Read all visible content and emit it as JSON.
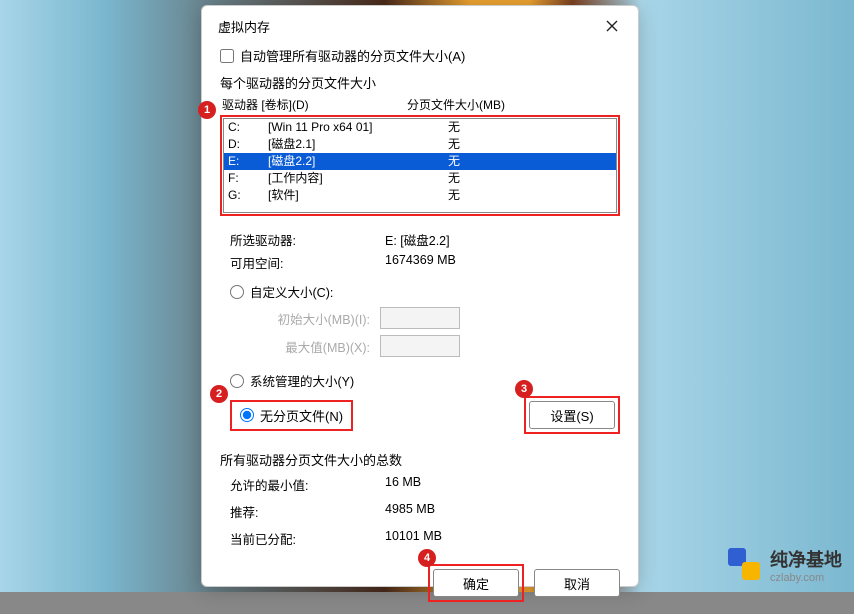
{
  "dialog": {
    "title": "虚拟内存",
    "checkbox_auto": "自动管理所有驱动器的分页文件大小(A)",
    "section_each": "每个驱动器的分页文件大小",
    "header_drive": "驱动器 [卷标](D)",
    "header_paging": "分页文件大小(MB)"
  },
  "drives": [
    {
      "letter": "C:",
      "label": "[Win 11 Pro x64 01]",
      "size": "无",
      "selected": false
    },
    {
      "letter": "D:",
      "label": "[磁盘2.1]",
      "size": "无",
      "selected": false
    },
    {
      "letter": "E:",
      "label": "[磁盘2.2]",
      "size": "无",
      "selected": true
    },
    {
      "letter": "F:",
      "label": "[工作内容]",
      "size": "无",
      "selected": false
    },
    {
      "letter": "G:",
      "label": "[软件]",
      "size": "无",
      "selected": false
    }
  ],
  "selected_drive": {
    "label": "所选驱动器:",
    "value": "E:  [磁盘2.2]"
  },
  "free_space": {
    "label": "可用空间:",
    "value": "1674369 MB"
  },
  "radio_custom": "自定义大小(C):",
  "input_initial": "初始大小(MB)(I):",
  "input_max": "最大值(MB)(X):",
  "radio_system": "系统管理的大小(Y)",
  "radio_none": "无分页文件(N)",
  "btn_set": "设置(S)",
  "totals_title": "所有驱动器分页文件大小的总数",
  "min_allowed": {
    "label": "允许的最小值:",
    "value": "16 MB"
  },
  "recommended": {
    "label": "推荐:",
    "value": "4985 MB"
  },
  "current": {
    "label": "当前已分配:",
    "value": "10101 MB"
  },
  "btn_ok": "确定",
  "btn_cancel": "取消",
  "badges": {
    "b1": "1",
    "b2": "2",
    "b3": "3",
    "b4": "4"
  },
  "watermark": {
    "name": "纯净基地",
    "url": "czlaby.com"
  }
}
